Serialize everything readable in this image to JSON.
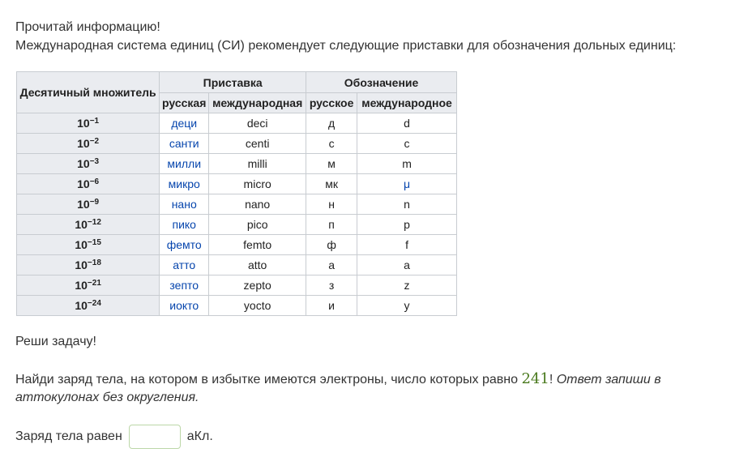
{
  "intro": {
    "line1": "Прочитай информацию!",
    "line2": "Международная система единиц (СИ) рекомендует следующие приставки для обозначения дольных единиц:"
  },
  "table": {
    "headers": {
      "multiplier": "Десятичный множитель",
      "prefix": "Приставка",
      "symbol": "Обозначение",
      "russian": "русская",
      "international": "международная",
      "russian_symbol": "русское",
      "international_symbol": "международное"
    },
    "rows": [
      {
        "base": "10",
        "exp": "−1",
        "ru": "деци",
        "intl": "deci",
        "ru_sym": "д",
        "intl_sym": "d"
      },
      {
        "base": "10",
        "exp": "−2",
        "ru": "санти",
        "intl": "centi",
        "ru_sym": "с",
        "intl_sym": "c"
      },
      {
        "base": "10",
        "exp": "−3",
        "ru": "милли",
        "intl": "milli",
        "ru_sym": "м",
        "intl_sym": "m"
      },
      {
        "base": "10",
        "exp": "−6",
        "ru": "микро",
        "intl": "micro",
        "ru_sym": "мк",
        "intl_sym": "μ"
      },
      {
        "base": "10",
        "exp": "−9",
        "ru": "нано",
        "intl": "nano",
        "ru_sym": "н",
        "intl_sym": "n"
      },
      {
        "base": "10",
        "exp": "−12",
        "ru": "пико",
        "intl": "pico",
        "ru_sym": "п",
        "intl_sym": "p"
      },
      {
        "base": "10",
        "exp": "−15",
        "ru": "фемто",
        "intl": "femto",
        "ru_sym": "ф",
        "intl_sym": "f"
      },
      {
        "base": "10",
        "exp": "−18",
        "ru": "атто",
        "intl": "atto",
        "ru_sym": "а",
        "intl_sym": "a"
      },
      {
        "base": "10",
        "exp": "−21",
        "ru": "зепто",
        "intl": "zepto",
        "ru_sym": "з",
        "intl_sym": "z"
      },
      {
        "base": "10",
        "exp": "−24",
        "ru": "иокто",
        "intl": "yocto",
        "ru_sym": "и",
        "intl_sym": "y"
      }
    ]
  },
  "task": {
    "intro": "Реши задачу!",
    "text_before": "Найди заряд тела, на котором в избытке имеются электроны, число которых равно ",
    "number": "241",
    "text_after": "! ",
    "hint": "Ответ запиши в аттокулонах без округления."
  },
  "answer": {
    "label": "Заряд тела равен",
    "value": "",
    "unit": "аКл."
  },
  "colors": {
    "link": "#0645ad",
    "number": "#4a7a1e",
    "header_bg": "#eaecf0",
    "border": "#c8ccd1",
    "input_border": "#bcd7a8"
  }
}
